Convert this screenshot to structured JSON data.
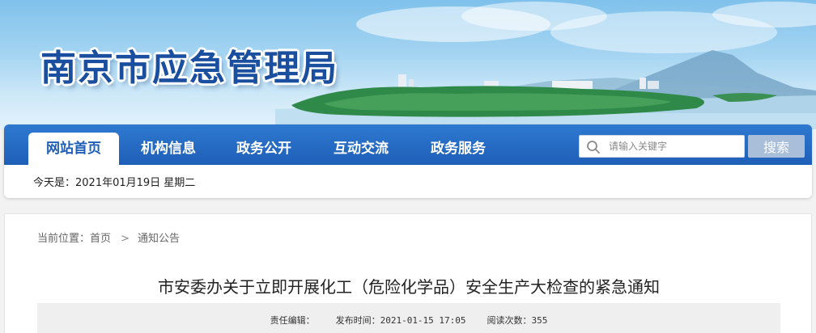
{
  "site": {
    "title": "南京市应急管理局"
  },
  "nav": {
    "items": [
      {
        "label": "网站首页",
        "active": true
      },
      {
        "label": "机构信息",
        "active": false
      },
      {
        "label": "政务公开",
        "active": false
      },
      {
        "label": "互动交流",
        "active": false
      },
      {
        "label": "政务服务",
        "active": false
      }
    ],
    "search_placeholder": "请输入关键字",
    "search_button": "搜索",
    "search_icon": "search-icon"
  },
  "date_line": "今天是：2021年01月19日  星期二",
  "breadcrumb": {
    "prefix": "当前位置：",
    "home": "首页",
    "separator": ">",
    "current": "通知公告"
  },
  "article": {
    "title": "市安委办关于立即开展化工（危险化学品）安全生产大检查的紧急通知",
    "editor_label": "责任编辑：",
    "publish_label": "发布时间：",
    "publish_time": "2021-01-15 17:05",
    "views_label": "阅读次数：",
    "views": "355"
  },
  "colors": {
    "nav_blue": "#1f5fb8",
    "title_blue": "#1a4fa0",
    "search_button": "#a9bfd9"
  }
}
